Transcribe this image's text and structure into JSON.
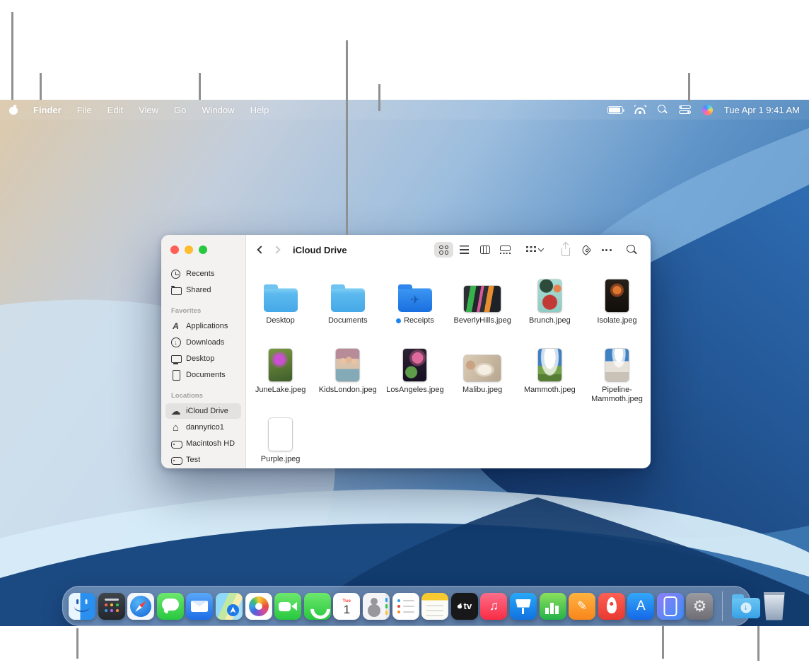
{
  "menu_bar": {
    "apple_menu_icon": "apple-logo-icon",
    "items": [
      "Finder",
      "File",
      "Edit",
      "View",
      "Go",
      "Window",
      "Help"
    ],
    "active_app": "Finder",
    "status_icons": [
      "battery-icon",
      "wifi-icon",
      "spotlight-search-icon",
      "control-center-icon",
      "siri-icon"
    ],
    "clock": "Tue Apr 1  9:41 AM"
  },
  "finder_window": {
    "traffic_lights": [
      "close",
      "minimize",
      "zoom"
    ],
    "toolbar": {
      "back_icon": "chevron-left-icon",
      "forward_icon": "chevron-right-icon",
      "title": "iCloud Drive",
      "view_icons": [
        "icon-view",
        "list-view",
        "column-view",
        "gallery-view"
      ],
      "group_icon": "group-by-icon",
      "action_icons": [
        "share-icon",
        "tag-icon",
        "more-icon"
      ],
      "search_icon": "search-icon"
    },
    "sidebar": {
      "top": [
        {
          "label": "Recents",
          "icon": "clock-icon"
        },
        {
          "label": "Shared",
          "icon": "shared-folder-icon"
        }
      ],
      "favorites_header": "Favorites",
      "favorites": [
        {
          "label": "Applications",
          "icon": "applications-icon"
        },
        {
          "label": "Downloads",
          "icon": "downloads-icon"
        },
        {
          "label": "Desktop",
          "icon": "desktop-icon"
        },
        {
          "label": "Documents",
          "icon": "document-icon"
        }
      ],
      "locations_header": "Locations",
      "locations": [
        {
          "label": "iCloud Drive",
          "icon": "icloud-icon",
          "selected": true
        },
        {
          "label": "dannyrico1",
          "icon": "home-icon"
        },
        {
          "label": "Macintosh HD",
          "icon": "hard-drive-icon"
        },
        {
          "label": "Test",
          "icon": "hard-drive-icon"
        }
      ]
    },
    "files": [
      {
        "name": "Desktop",
        "kind": "folder"
      },
      {
        "name": "Documents",
        "kind": "folder"
      },
      {
        "name": "Receipts",
        "kind": "folder",
        "badge": "blue-dot",
        "glyph": "airplane"
      },
      {
        "name": "BeverlyHills.jpeg",
        "kind": "image"
      },
      {
        "name": "Brunch.jpeg",
        "kind": "image"
      },
      {
        "name": "Isolate.jpeg",
        "kind": "image"
      },
      {
        "name": "JuneLake.jpeg",
        "kind": "image"
      },
      {
        "name": "KidsLondon.jpeg",
        "kind": "image"
      },
      {
        "name": "LosAngeles.jpeg",
        "kind": "image"
      },
      {
        "name": "Malibu.jpeg",
        "kind": "image"
      },
      {
        "name": "Mammoth.jpeg",
        "kind": "image"
      },
      {
        "name": "Pipeline-Mammoth.jpeg",
        "kind": "image"
      },
      {
        "name": "Purple.jpeg",
        "kind": "image"
      }
    ]
  },
  "dock": {
    "apps": [
      "finder",
      "launchpad",
      "safari",
      "messages",
      "mail",
      "maps",
      "photos",
      "facetime",
      "phone",
      "calendar",
      "contacts",
      "reminders",
      "notes",
      "apple-tv",
      "music",
      "keynote",
      "numbers",
      "pages",
      "rocket",
      "app-store",
      "iphone-mirroring",
      "system-settings"
    ],
    "calendar": {
      "weekday": "Tue",
      "day": "1"
    },
    "apple_tv_label": "tv",
    "app_store_letter": "A",
    "running_app": "finder",
    "extras": [
      "downloads-folder",
      "trash"
    ]
  },
  "colors": {
    "folder_blue": "#46a8e8",
    "receipts_folder_blue": "#1a6fe0",
    "selection_pill": "#e4e2e0",
    "file_badge_blue": "#1f86f0",
    "callout_line_gray": "#8f9091"
  }
}
